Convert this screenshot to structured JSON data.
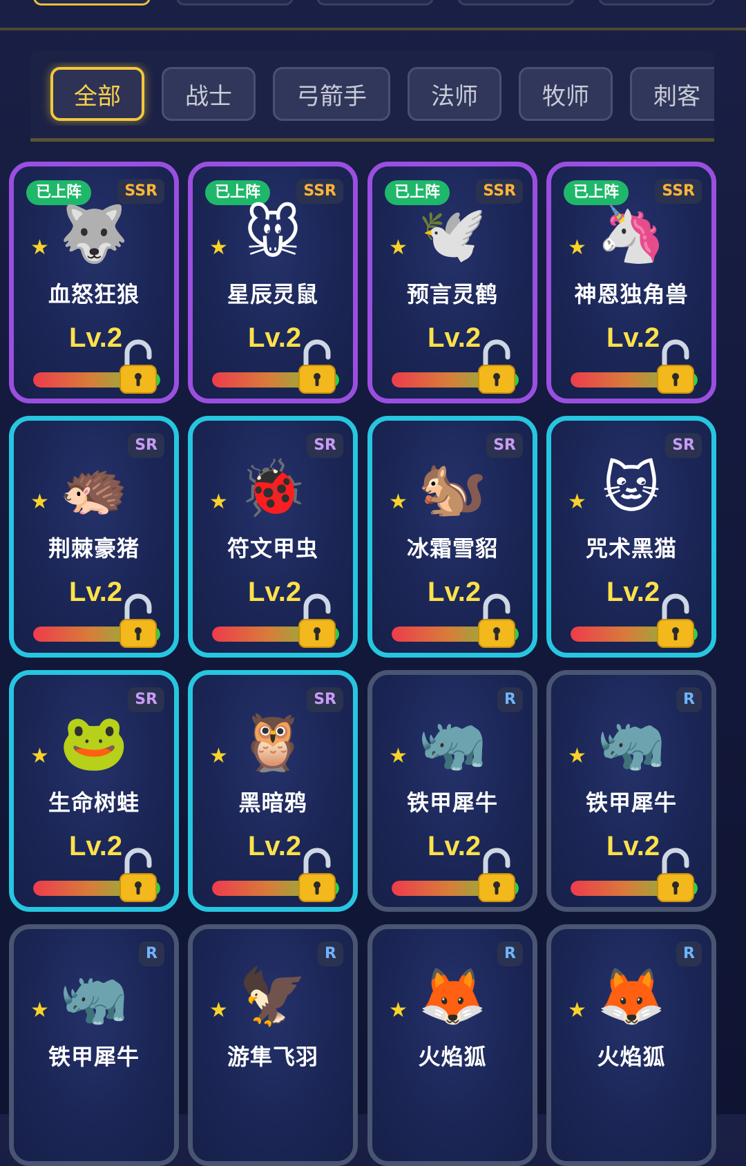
{
  "filters": [
    {
      "label": "全部",
      "active": true
    },
    {
      "label": "战士",
      "active": false
    },
    {
      "label": "弓箭手",
      "active": false
    },
    {
      "label": "法师",
      "active": false
    },
    {
      "label": "牧师",
      "active": false
    },
    {
      "label": "刺客",
      "active": false
    }
  ],
  "deployed_label": "已上阵",
  "cards": [
    {
      "name": "血怒狂狼",
      "rarity": "SSR",
      "level": "Lv.2",
      "deployed": true,
      "emoji": "🐺",
      "progress": 1.0
    },
    {
      "name": "星辰灵鼠",
      "rarity": "SSR",
      "level": "Lv.2",
      "deployed": true,
      "emoji": "🐭",
      "progress": 1.0
    },
    {
      "name": "预言灵鹤",
      "rarity": "SSR",
      "level": "Lv.2",
      "deployed": true,
      "emoji": "🕊️",
      "progress": 1.0
    },
    {
      "name": "神恩独角兽",
      "rarity": "SSR",
      "level": "Lv.2",
      "deployed": true,
      "emoji": "🦄",
      "progress": 1.0
    },
    {
      "name": "荆棘豪猪",
      "rarity": "SR",
      "level": "Lv.2",
      "deployed": false,
      "emoji": "🦔",
      "progress": 1.0
    },
    {
      "name": "符文甲虫",
      "rarity": "SR",
      "level": "Lv.2",
      "deployed": false,
      "emoji": "🐞",
      "progress": 1.0
    },
    {
      "name": "冰霜雪貂",
      "rarity": "SR",
      "level": "Lv.2",
      "deployed": false,
      "emoji": "🐿️",
      "progress": 1.0
    },
    {
      "name": "咒术黑猫",
      "rarity": "SR",
      "level": "Lv.2",
      "deployed": false,
      "emoji": "🐱",
      "progress": 1.0
    },
    {
      "name": "生命树蛙",
      "rarity": "SR",
      "level": "Lv.2",
      "deployed": false,
      "emoji": "🐸",
      "progress": 1.0
    },
    {
      "name": "黑暗鸦",
      "rarity": "SR",
      "level": "Lv.2",
      "deployed": false,
      "emoji": "🦉",
      "progress": 1.0
    },
    {
      "name": "铁甲犀牛",
      "rarity": "R",
      "level": "Lv.2",
      "deployed": false,
      "emoji": "🦏",
      "progress": 1.0
    },
    {
      "name": "铁甲犀牛",
      "rarity": "R",
      "level": "Lv.2",
      "deployed": false,
      "emoji": "🦏",
      "progress": 1.0
    },
    {
      "name": "铁甲犀牛",
      "rarity": "R",
      "level": "",
      "deployed": false,
      "emoji": "🦏",
      "progress": null
    },
    {
      "name": "游隼飞羽",
      "rarity": "R",
      "level": "",
      "deployed": false,
      "emoji": "🦅",
      "progress": null
    },
    {
      "name": "火焰狐",
      "rarity": "R",
      "level": "",
      "deployed": false,
      "emoji": "🦊",
      "progress": null
    },
    {
      "name": "火焰狐",
      "rarity": "R",
      "level": "",
      "deployed": false,
      "emoji": "🦊",
      "progress": null
    }
  ]
}
